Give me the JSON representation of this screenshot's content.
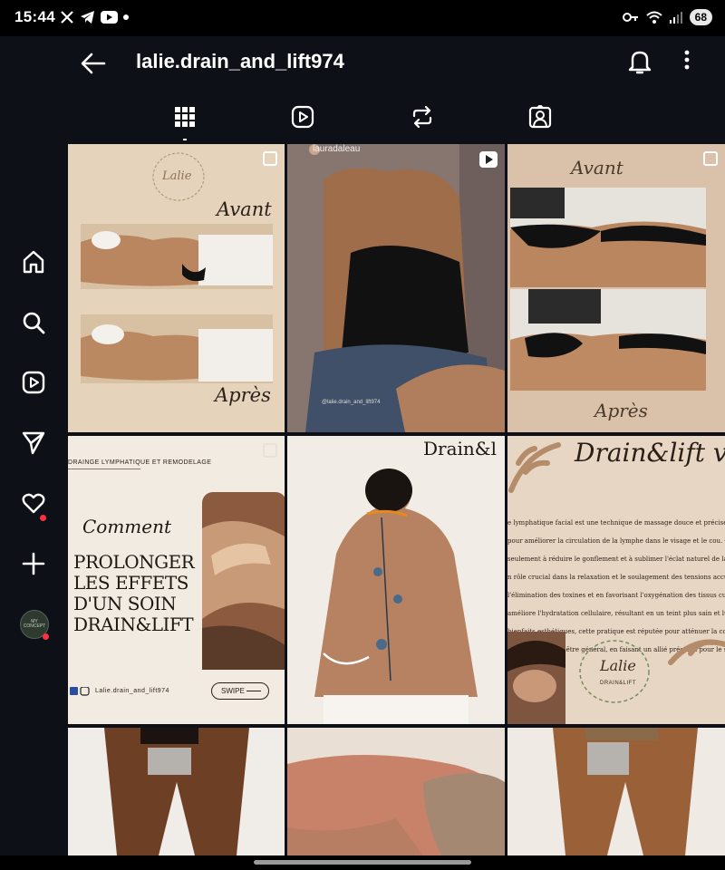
{
  "status_bar": {
    "time": "15:44",
    "battery": "68",
    "left_icons": [
      "x-icon",
      "telegram-icon",
      "youtube-icon",
      "dot-icon"
    ],
    "right_icons": [
      "key-icon",
      "wifi-icon",
      "signal-icon"
    ]
  },
  "header": {
    "username": "lalie.drain_and_lift974"
  },
  "nav": {
    "items": [
      "home-icon",
      "search-icon",
      "reels-icon",
      "direct-icon",
      "activity-icon",
      "create-icon"
    ],
    "avatar_label": "MY CONCEPT"
  },
  "tabs": [
    "grid-tab",
    "reels-tab",
    "reposts-tab",
    "tagged-tab"
  ],
  "posts": {
    "p1": {
      "top_logo": "Lalie",
      "before": "Avant",
      "after": "Après"
    },
    "p2": {
      "handle": "lauradaleau",
      "caption": "@lalie.drain_and_lift974"
    },
    "p3": {
      "before": "Avant",
      "after": "Après"
    },
    "p4": {
      "kicker": "DRAINGE LYMPHATIQUE ET REMODELAGE",
      "script": "Comment",
      "headline_1": "PROLONGER",
      "headline_2": "LES EFFETS",
      "headline_3": "D'UN SOIN",
      "headline_4": "DRAIN&LIFT",
      "handle": "Lalie.drain_and_lift974",
      "swipe": "SWIPE"
    },
    "p5": {
      "brand": "Drain&l"
    },
    "p6": {
      "title": "Drain&lift vis",
      "logo": "Lalie",
      "logo_sub": "DRAIN&LIFT",
      "lines": [
        "e lymphatique facial est une technique de massage douce et précise qui stimule",
        "pour améliorer la circulation de la lymphe dans le visage et le cou. Ce process",
        "seulement à réduire le gonflement et à sublimer l'éclat naturel de la peau, m",
        "n rôle crucial dans la relaxation et le soulagement des tensions accumulées.",
        "l'élimination des toxines et en favorisant l'oxygénation des tissus cutanés, le",
        "améliore l'hydratation cellulaire, résultant en un teint plus sain et lumineux.",
        "bienfaits esthétiques, cette pratique est réputée pour atténuer la congestio",
        "sensation de bien-être général, en faisant un allié précieux pour le soin et la s"
      ]
    }
  }
}
